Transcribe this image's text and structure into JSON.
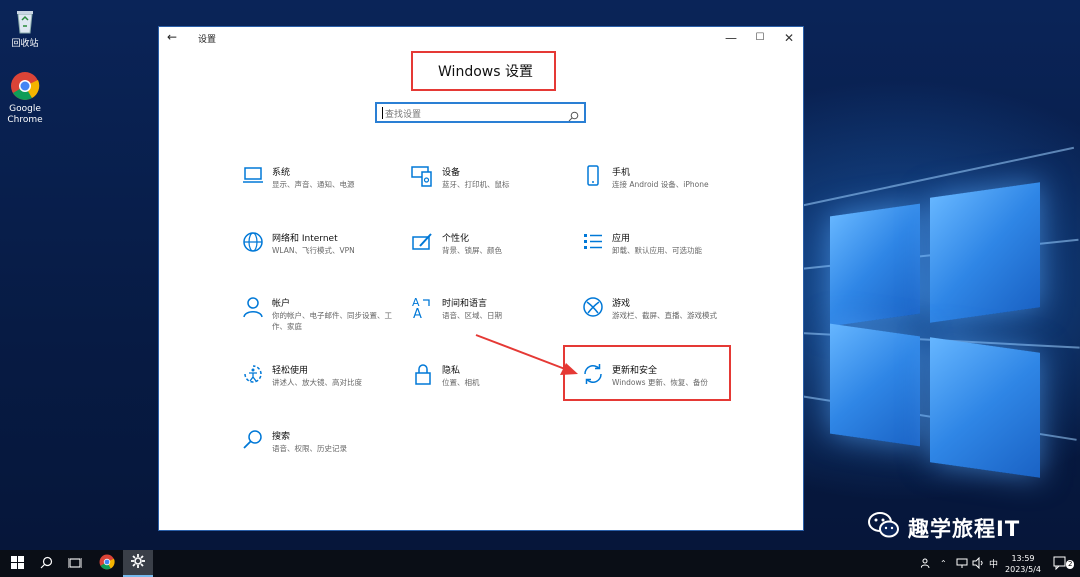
{
  "desktop": {
    "icons": [
      {
        "label": "回收站"
      },
      {
        "label": "Google Chrome"
      }
    ]
  },
  "window": {
    "title": "设置",
    "back_icon": "←",
    "min_icon": "—",
    "max_icon": "☐",
    "close_icon": "✕",
    "heading": "Windows 设置",
    "search_placeholder": "查找设置"
  },
  "tiles": [
    {
      "title": "系统",
      "desc": "显示、声音、通知、电源",
      "icon": "laptop-icon"
    },
    {
      "title": "设备",
      "desc": "蓝牙、打印机、鼠标",
      "icon": "devices-icon"
    },
    {
      "title": "手机",
      "desc": "连接 Android 设备、iPhone",
      "icon": "phone-icon"
    },
    {
      "title": "网络和 Internet",
      "desc": "WLAN、飞行模式、VPN",
      "icon": "globe-icon"
    },
    {
      "title": "个性化",
      "desc": "背景、锁屏、颜色",
      "icon": "brush-icon"
    },
    {
      "title": "应用",
      "desc": "卸载、默认应用、可选功能",
      "icon": "apps-list-icon"
    },
    {
      "title": "帐户",
      "desc": "你的帐户、电子邮件、同步设置、工作、家庭",
      "icon": "person-icon"
    },
    {
      "title": "时间和语言",
      "desc": "语音、区域、日期",
      "icon": "time-language-icon"
    },
    {
      "title": "游戏",
      "desc": "游戏栏、截屏、直播、游戏模式",
      "icon": "xbox-icon"
    },
    {
      "title": "轻松使用",
      "desc": "讲述人、放大镜、高对比度",
      "icon": "ease-of-access-icon"
    },
    {
      "title": "隐私",
      "desc": "位置、相机",
      "icon": "lock-icon"
    },
    {
      "title": "更新和安全",
      "desc": "Windows 更新、恢复、备份",
      "icon": "sync-icon"
    },
    {
      "title": "搜索",
      "desc": "语音、权限、历史记录",
      "icon": "search-icon"
    }
  ],
  "taskbar": {
    "ime": "中",
    "time": "13:59",
    "date": "2023/5/4",
    "notification_count": "2"
  },
  "watermark": {
    "text": "趣学旅程IT"
  },
  "colors": {
    "accent": "#0078d7",
    "highlight": "#e53935",
    "taskbar": "#0a0e16"
  }
}
